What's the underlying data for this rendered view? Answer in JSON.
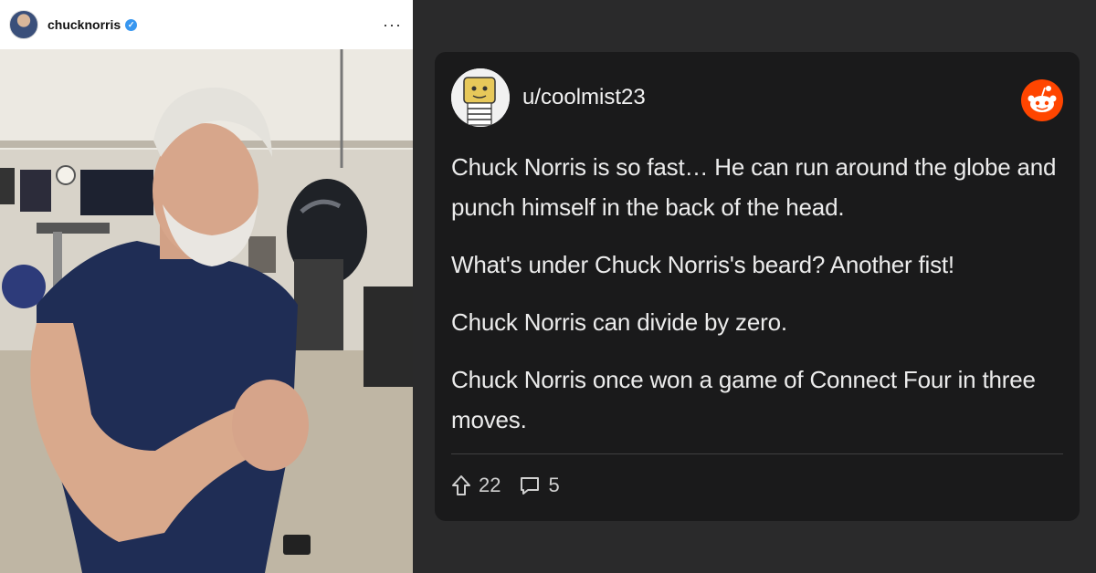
{
  "instagram": {
    "username": "chucknorris",
    "verified_icon": "verified-badge-icon",
    "more_icon": "more-options-icon",
    "more_label": "···",
    "photo_description": "photo-content"
  },
  "reddit": {
    "username": "u/coolmist23",
    "logo_icon": "reddit-logo-icon",
    "comments": [
      "Chuck Norris is so fast… He can run around the globe and punch himself in the back of the head.",
      "What's under Chuck Norris's beard? Another fist!",
      "Chuck Norris can divide by zero.",
      "Chuck Norris once won a game of Connect Four in three moves."
    ],
    "upvotes": "22",
    "replies": "5",
    "colors": {
      "card_bg": "#1a1a1b",
      "page_bg": "#2a2a2b",
      "reddit_orange": "#ff4500"
    }
  }
}
